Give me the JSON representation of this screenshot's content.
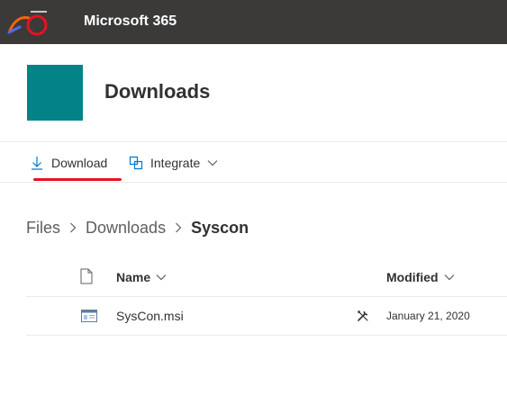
{
  "header": {
    "app_title": "Microsoft 365",
    "bg_color": "#3b3a39"
  },
  "site": {
    "title": "Downloads",
    "tile_color": "#038387"
  },
  "commands": [
    {
      "label": "Download",
      "icon": "download-arrow-icon",
      "active": true
    },
    {
      "label": "Integrate",
      "icon": "integrate-icon",
      "has_dropdown": true
    }
  ],
  "breadcrumb": [
    "Files",
    "Downloads",
    "Syscon"
  ],
  "table": {
    "columns": [
      "Name",
      "Modified"
    ],
    "rows": [
      {
        "name": "SysCon.msi",
        "modified": "January 21, 2020",
        "icon": "msi-file-icon",
        "status_icon": "tools-icon"
      }
    ]
  },
  "colors": {
    "accent_underline": "#e81123"
  }
}
